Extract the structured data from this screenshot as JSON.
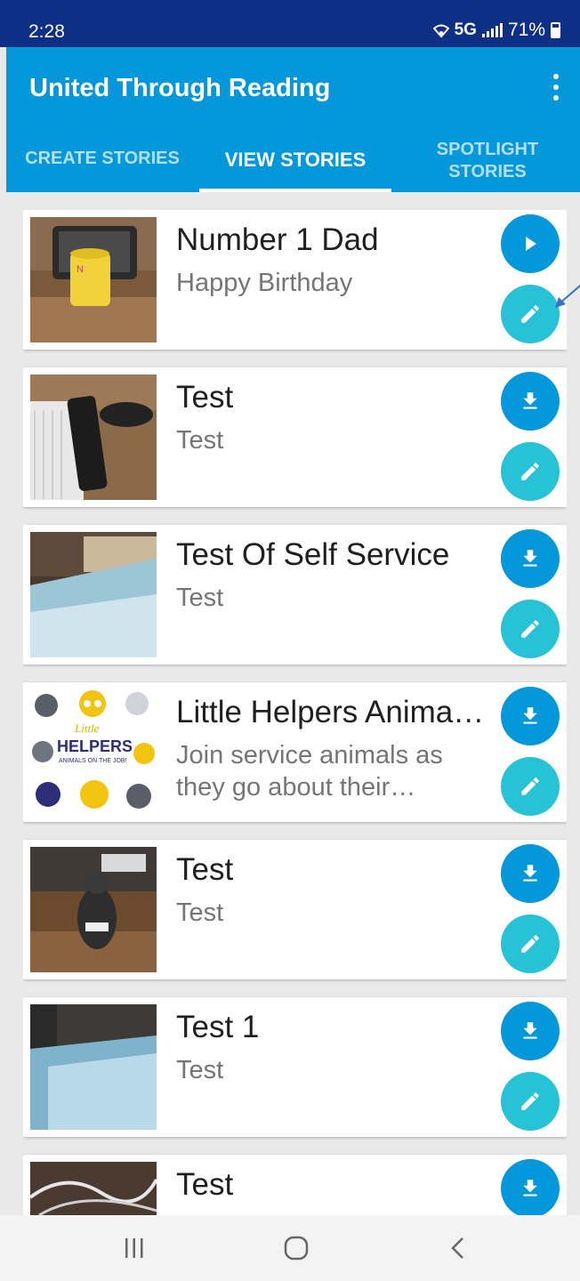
{
  "status_bar": {
    "time": "2:28",
    "network": "5G",
    "battery": "71%"
  },
  "app_bar": {
    "title": "United Through Reading",
    "menu_icon": "more-vert-icon"
  },
  "tabs": [
    {
      "label": "CREATE STORIES",
      "active": false
    },
    {
      "label": "VIEW STORIES",
      "active": true
    },
    {
      "label": "SPOTLIGHT STORIES",
      "active": false
    }
  ],
  "stories": [
    {
      "title": "Number 1 Dad",
      "subtitle": "Happy Birthday",
      "primary_action": "play-icon",
      "secondary_action": "edit-icon"
    },
    {
      "title": "Test",
      "subtitle": "Test",
      "primary_action": "download-icon",
      "secondary_action": "edit-icon"
    },
    {
      "title": "Test Of Self Service",
      "subtitle": "Test",
      "primary_action": "download-icon",
      "secondary_action": "edit-icon"
    },
    {
      "title": "Little Helpers Animals on the Job!",
      "subtitle": "Join service animals as they go about their important work",
      "primary_action": "download-icon",
      "secondary_action": "edit-icon"
    },
    {
      "title": "Test",
      "subtitle": "Test",
      "primary_action": "download-icon",
      "secondary_action": "edit-icon"
    },
    {
      "title": "Test 1",
      "subtitle": "Test",
      "primary_action": "download-icon",
      "secondary_action": "edit-icon"
    },
    {
      "title": "Test",
      "subtitle": "",
      "primary_action": "download-icon",
      "secondary_action": "edit-icon"
    }
  ],
  "thumbnail_art": {
    "little_helpers_logo_text": "Little HELPERS ANIMALS ON THE JOB!"
  },
  "nav_bar": {
    "recents": "recents-icon",
    "home": "home-icon",
    "back": "back-icon"
  },
  "colors": {
    "status_bar": "#0d2f86",
    "app_bar": "#0497d9",
    "fab_primary": "#0497d9",
    "fab_edit": "#27c2d5",
    "annotation": "#3a6fc4"
  }
}
